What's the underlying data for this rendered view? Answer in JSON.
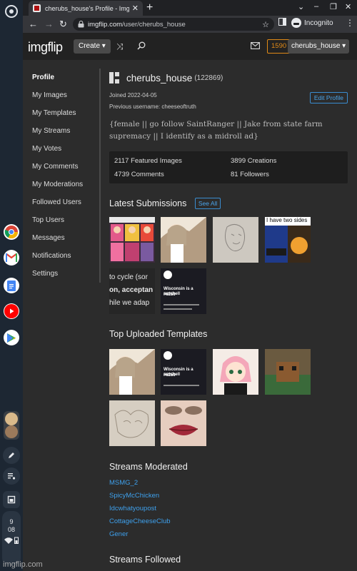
{
  "browser": {
    "tab_title": "cherubs_house's Profile - Imgflip",
    "url_domain": "imgflip.com",
    "url_path": "/user/cherubs_house",
    "incognito_label": "Incognito"
  },
  "header": {
    "logo": "imgflip",
    "create_label": "Create",
    "points": "1590",
    "username": "cherubs_house"
  },
  "sidebar": {
    "items": [
      {
        "label": "Profile",
        "active": true
      },
      {
        "label": "My Images"
      },
      {
        "label": "My Templates"
      },
      {
        "label": "My Streams"
      },
      {
        "label": "My Votes"
      },
      {
        "label": "My Comments"
      },
      {
        "label": "My Moderations"
      },
      {
        "label": "Followed Users"
      },
      {
        "label": "Top Users"
      },
      {
        "label": "Messages"
      },
      {
        "label": "Notifications"
      },
      {
        "label": "Settings"
      }
    ]
  },
  "profile": {
    "name": "cherubs_house",
    "points": "(122869)",
    "joined": "Joined 2022-04-05",
    "previous_username": "Previous username: cheeseoftruth",
    "edit_label": "Edit Profile",
    "bio": "{female || go follow SaintRanger || Jake from state farm supremacy || I identify as a midroll ad}",
    "stats": {
      "featured": "2117 Featured Images",
      "creations": "3899 Creations",
      "comments": "4739 Comments",
      "followers": "81 Followers"
    }
  },
  "latest": {
    "title": "Latest Submissions",
    "see_all": "See All",
    "thumb4_text": "I have two sides",
    "thumb5_text1": "to cycle (sor",
    "thumb5_text2": "on, acceptan",
    "thumb5_text3": "hile we adap",
    "thumb6_title": "Wisconsin is a nutshell",
    "thumb6_tag": "#6250"
  },
  "templates": {
    "title": "Top Uploaded Templates",
    "thumb2_title": "Wisconsin is a nutshell",
    "thumb2_tag": "#6250"
  },
  "streams_moderated": {
    "title": "Streams Moderated",
    "items": [
      "MSMG_2",
      "SpicyMcChicken",
      "Idcwhatyoupost",
      "CottageCheeseClub",
      "Gener"
    ]
  },
  "streams_followed": {
    "title": "Streams Followed"
  },
  "shelf": {
    "time_hour": "9",
    "time_min": "08"
  },
  "watermark": "imgflip.com"
}
